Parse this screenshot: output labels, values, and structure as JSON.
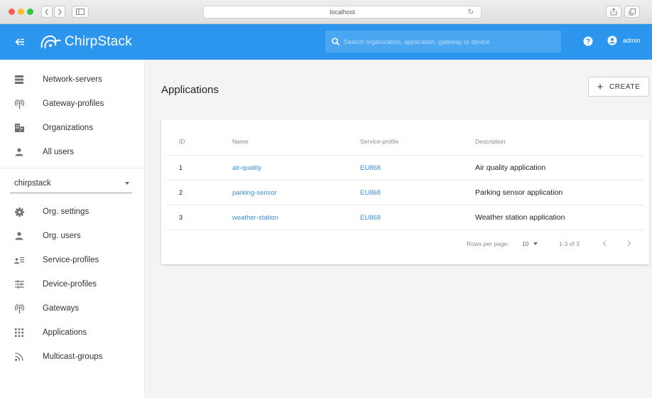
{
  "browser": {
    "url": "localhost"
  },
  "header": {
    "brand": "ChirpStack",
    "search_placeholder": "Search organization, application, gateway or device",
    "user": "admin"
  },
  "sidebar": {
    "admin_items": [
      {
        "label": "Network-servers",
        "icon": "server-icon"
      },
      {
        "label": "Gateway-profiles",
        "icon": "radio-tower-icon"
      },
      {
        "label": "Organizations",
        "icon": "building-icon"
      },
      {
        "label": "All users",
        "icon": "user-icon"
      }
    ],
    "organization": "chirpstack",
    "org_items": [
      {
        "label": "Org. settings",
        "icon": "gear-icon"
      },
      {
        "label": "Org. users",
        "icon": "user-icon"
      },
      {
        "label": "Service-profiles",
        "icon": "account-details-icon"
      },
      {
        "label": "Device-profiles",
        "icon": "tune-icon"
      },
      {
        "label": "Gateways",
        "icon": "radio-tower-icon"
      },
      {
        "label": "Applications",
        "icon": "apps-grid-icon"
      },
      {
        "label": "Multicast-groups",
        "icon": "rss-icon"
      }
    ]
  },
  "main": {
    "title": "Applications",
    "create_label": "CREATE",
    "table": {
      "columns": [
        "ID",
        "Name",
        "Service-profile",
        "Description"
      ],
      "rows": [
        {
          "id": "1",
          "name": "air-quality",
          "service_profile": "EU868",
          "description": "Air quality application"
        },
        {
          "id": "2",
          "name": "parking-sensor",
          "service_profile": "EU868",
          "description": "Parking sensor application"
        },
        {
          "id": "3",
          "name": "weather-station",
          "service_profile": "EU868",
          "description": "Weather station application"
        }
      ]
    },
    "pagination": {
      "rows_per_page_label": "Rows per page:",
      "rows_per_page": "10",
      "range": "1-3 of 3"
    }
  },
  "colors": {
    "primary": "#2c96ee",
    "link": "#3a8fd8"
  }
}
